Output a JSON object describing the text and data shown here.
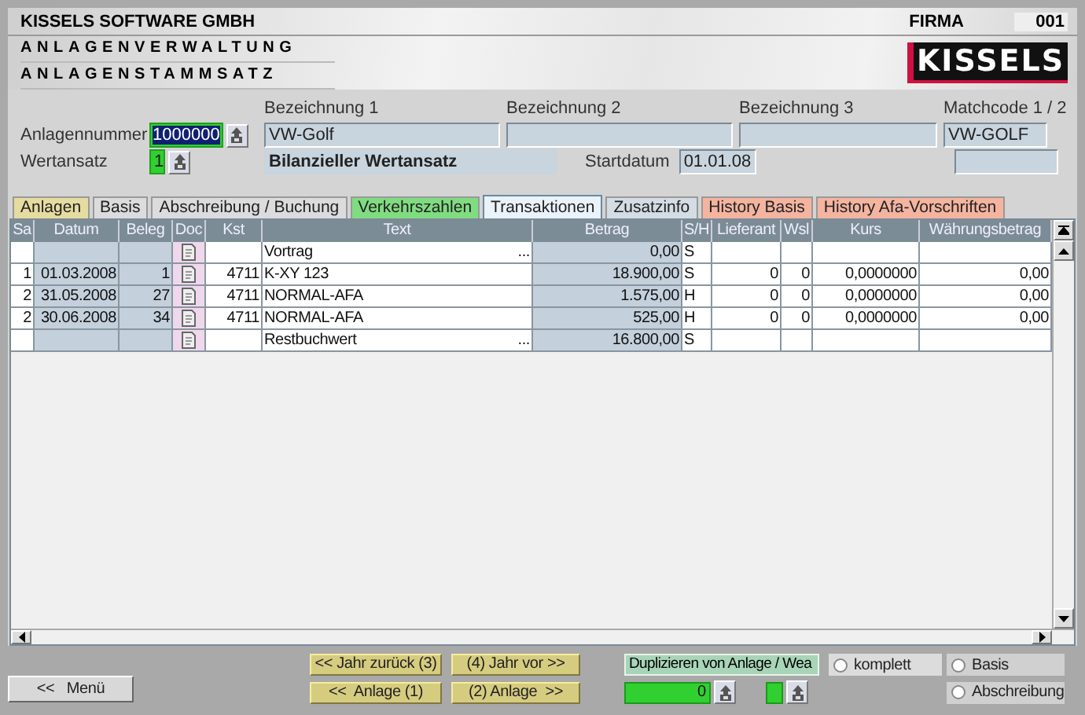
{
  "header": {
    "company": "KISSELS SOFTWARE GMBH",
    "firma_label": "FIRMA",
    "firma_value": "001",
    "module_title": "ANLAGENVERWALTUNG",
    "screen_title": "ANLAGENSTAMMSATZ",
    "logo": "KISSELS"
  },
  "form": {
    "anlagennummer": {
      "label": "Anlagennummer",
      "value": "1000000"
    },
    "wertansatz": {
      "label": "Wertansatz",
      "value": "1"
    },
    "bezeichnungen": [
      {
        "label": "Bezeichnung 1",
        "value": "VW-Golf"
      },
      {
        "label": "Bezeichnung 2"
      },
      {
        "label": "Bezeichnung 3"
      }
    ],
    "wertansatz_name": "Bilanzieller Wertansatz",
    "startdatum": {
      "label": "Startdatum",
      "value": "01.01.08"
    },
    "matchcode": {
      "label": "Matchcode 1 / 2",
      "values": [
        "VW-GOLF"
      ]
    }
  },
  "tabs": [
    {
      "label": "Anlagen",
      "selected": false,
      "color": "#e6dca0"
    },
    {
      "label": "Basis",
      "selected": false,
      "color": "#dcdcdc"
    },
    {
      "label": "Abschreibung / Buchung",
      "selected": false,
      "color": "#dcdcdc"
    },
    {
      "label": "Verkehrszahlen",
      "selected": false,
      "color": "#80dc80"
    },
    {
      "label": "Transaktionen",
      "selected": true,
      "color": "#dce8f2"
    },
    {
      "label": "Zusatzinfo",
      "selected": false,
      "color": "#d4dce4"
    },
    {
      "label": "History Basis",
      "selected": false,
      "color": "#f4b4a0"
    },
    {
      "label": "History Afa-Vorschriften",
      "selected": false,
      "color": "#f4b4a0"
    }
  ],
  "table": {
    "columns": [
      {
        "label": "Sa",
        "readonly": false
      },
      {
        "label": "Datum",
        "readonly": true
      },
      {
        "label": "Beleg",
        "readonly": true
      },
      {
        "label": "Doc",
        "readonly": false
      },
      {
        "label": "Kst",
        "readonly": false
      },
      {
        "label": "Text",
        "readonly": false
      },
      {
        "label": "Betrag",
        "readonly": true
      },
      {
        "label": "S/H",
        "readonly": false
      },
      {
        "label": "Lieferant",
        "readonly": false
      },
      {
        "label": "Wsl",
        "readonly": false
      },
      {
        "label": "Kurs",
        "readonly": false
      },
      {
        "label": "Währungsbetrag",
        "readonly": false
      }
    ],
    "rows": [
      {
        "sa": "",
        "datum": "",
        "beleg": "",
        "kst": "",
        "text": "Vortrag",
        "more": "...",
        "betrag": "0,00",
        "sh": "S",
        "lieferant": "",
        "wsl": "",
        "kurs": "",
        "waehrungsbetrag": ""
      },
      {
        "sa": "1",
        "datum": "01.03.2008",
        "beleg": "1",
        "kst": "4711",
        "text": "K-XY 123",
        "more": "",
        "betrag": "18.900,00",
        "sh": "S",
        "lieferant": "0",
        "wsl": "0",
        "kurs": "0,0000000",
        "waehrungsbetrag": "0,00"
      },
      {
        "sa": "2",
        "datum": "31.05.2008",
        "beleg": "27",
        "kst": "4711",
        "text": "NORMAL-AFA",
        "more": "",
        "betrag": "1.575,00",
        "sh": "H",
        "lieferant": "0",
        "wsl": "0",
        "kurs": "0,0000000",
        "waehrungsbetrag": "0,00"
      },
      {
        "sa": "2",
        "datum": "30.06.2008",
        "beleg": "34",
        "kst": "4711",
        "text": "NORMAL-AFA",
        "more": "",
        "betrag": "525,00",
        "sh": "H",
        "lieferant": "0",
        "wsl": "0",
        "kurs": "0,0000000",
        "waehrungsbetrag": "0,00"
      },
      {
        "sa": "",
        "datum": "",
        "beleg": "",
        "kst": "",
        "text": "Restbuchwert",
        "more": "...",
        "betrag": "16.800,00",
        "sh": "S",
        "lieferant": "",
        "wsl": "",
        "kurs": "",
        "waehrungsbetrag": ""
      }
    ]
  },
  "footer": {
    "menu_button": "<<   Menü",
    "nav_buttons": [
      "<< Jahr zurück (3)",
      "(4) Jahr vor >>",
      "<<  Anlage (1)",
      "(2) Anlage  >>"
    ],
    "duplicate_label": "Duplizieren von Anlage / Wea",
    "duplicate_anlage": "0",
    "options": [
      {
        "label": "komplett",
        "selected": false
      },
      {
        "label": "Basis",
        "selected": false
      },
      {
        "label": "Abschreibung",
        "selected": false
      }
    ]
  }
}
